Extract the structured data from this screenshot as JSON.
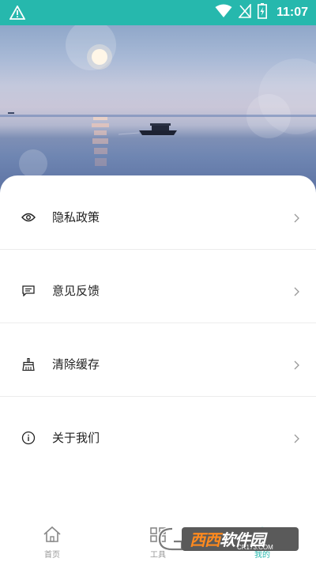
{
  "status_bar": {
    "time": "11:07"
  },
  "hero": {
    "description_icon": "sunset-sea-image"
  },
  "menu": [
    {
      "label": "隐私政策",
      "icon": "eye-icon"
    },
    {
      "label": "意见反馈",
      "icon": "message-icon"
    },
    {
      "label": "清除缓存",
      "icon": "broom-icon"
    },
    {
      "label": "关于我们",
      "icon": "info-icon"
    }
  ],
  "tabs": [
    {
      "label": "首页",
      "icon": "home-icon",
      "active": false
    },
    {
      "label": "工具",
      "icon": "tools-icon",
      "active": false
    },
    {
      "label": "我的",
      "icon": "user-icon",
      "active": true
    }
  ],
  "watermark": {
    "brand": "西西软件园",
    "brand_part1": "西西",
    "brand_part2": "软件园",
    "url": "CR173.COM"
  },
  "colors": {
    "accent": "#26b8ad",
    "text": "#222222",
    "muted": "#999999"
  }
}
